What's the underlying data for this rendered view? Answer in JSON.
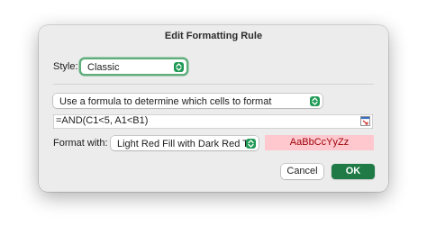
{
  "dialog": {
    "title": "Edit Formatting Rule"
  },
  "style": {
    "label": "Style:",
    "value": "Classic"
  },
  "rule_type": {
    "value": "Use a formula to determine which cells to format"
  },
  "formula": {
    "value": "=AND(C1<5, A1<B1)"
  },
  "format_with": {
    "label": "Format with:",
    "value": "Light Red Fill with Dark Red T...",
    "preview_text": "AaBbCcYyZz",
    "preview_fill": "#ffc7ce",
    "preview_text_color": "#9c0006"
  },
  "buttons": {
    "cancel": "Cancel",
    "ok": "OK"
  },
  "colors": {
    "accent": "#1f7a46",
    "stepper": "#1f9a55",
    "focus_ring": "#5fae7b"
  },
  "icons": {
    "stepper": "chevron-up-down-icon",
    "range_picker": "collapse-dialog-icon"
  }
}
